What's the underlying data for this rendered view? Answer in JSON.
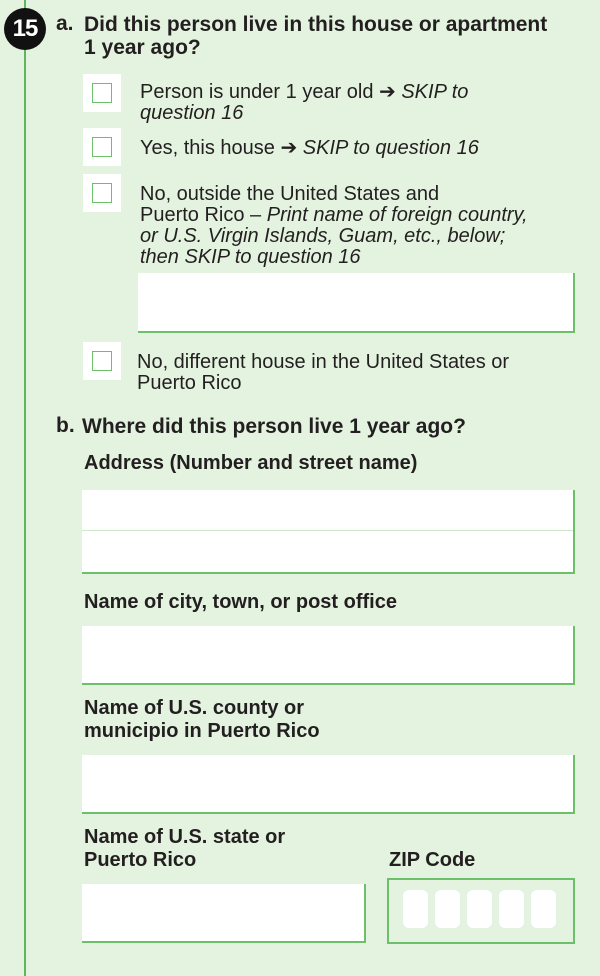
{
  "question": {
    "number": "15",
    "part_a": {
      "letter": "a.",
      "text_line1": "Did this person live in this house or apartment",
      "text_line2": "1 year ago?",
      "options": [
        {
          "main": "Person is under 1 year old ➔ ",
          "skip_line1": "SKIP to",
          "skip_line2": "question 16"
        },
        {
          "main": "Yes, this house ➔ ",
          "skip": "SKIP to question 16"
        },
        {
          "line1": "No, outside the United States and",
          "line2_plain": "Puerto Rico – ",
          "line2_italic": "Print name of foreign country,",
          "line3": "or U.S. Virgin Islands, Guam, etc., below;",
          "line4": "then SKIP to question 16"
        },
        {
          "line1": "No, different house in the United States or",
          "line2": "Puerto Rico"
        }
      ]
    },
    "part_b": {
      "letter": "b.",
      "text": "Where did this person live 1 year ago?",
      "address_label": "Address (Number and street name)",
      "city_label": "Name of city, town, or post office",
      "county_label_line1": "Name of U.S. county or",
      "county_label_line2": "municipio in Puerto Rico",
      "state_label_line1": "Name of U.S. state or",
      "state_label_line2": "Puerto Rico",
      "zip_label": "ZIP Code"
    }
  },
  "colors": {
    "background": "#e3f3df",
    "accent": "#6cc06a",
    "rule": "#5cb85a",
    "text": "#231f20"
  }
}
